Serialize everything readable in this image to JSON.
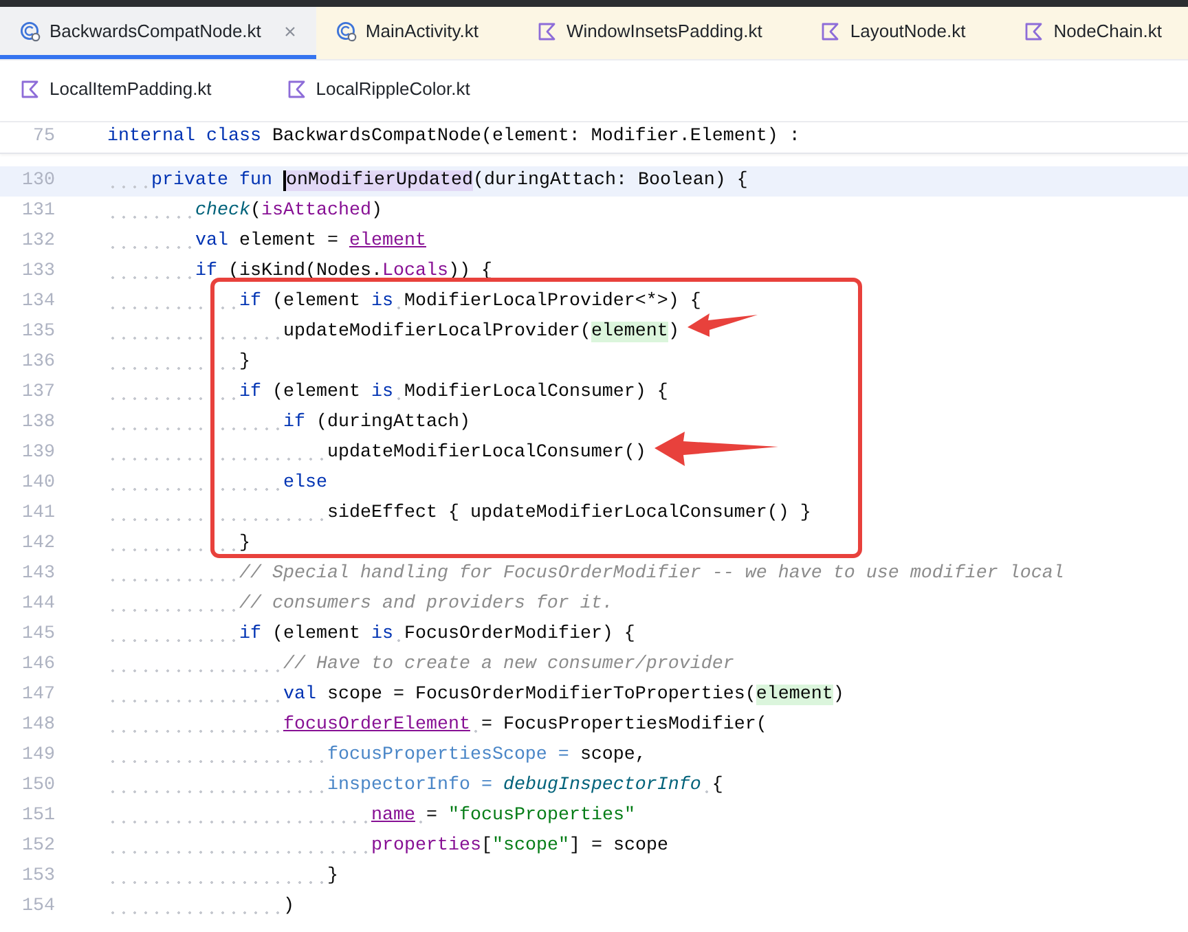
{
  "tab_rows": [
    [
      {
        "label": "BackwardsCompatNode.kt",
        "kind": "class",
        "selected": true
      },
      {
        "label": "MainActivity.kt",
        "kind": "class",
        "selected": false
      },
      {
        "label": "WindowInsetsPadding.kt",
        "kind": "kotlin",
        "selected": false
      },
      {
        "label": "LayoutNode.kt",
        "kind": "kotlin",
        "selected": false
      },
      {
        "label": "NodeChain.kt",
        "kind": "kotlin",
        "selected": false
      }
    ],
    [
      {
        "label": "LocalItemPadding.kt",
        "kind": "kotlin",
        "selected": false
      },
      {
        "label": "LocalRippleColor.kt",
        "kind": "kotlin",
        "selected": false
      }
    ]
  ],
  "sticky_line": {
    "number": "75",
    "tokens": [
      {
        "text": "internal class ",
        "kind": "kw"
      },
      {
        "text": "BackwardsCompatNode(element: Modifier.Element) :",
        "kind": "plain"
      }
    ]
  },
  "lines": [
    {
      "number": "130",
      "current": true,
      "tokens": [
        {
          "text": "    private fun ",
          "kind": "kw"
        },
        {
          "text": "onModifierUpdated",
          "kind": "plain",
          "declaration": true,
          "caret": true
        },
        {
          "text": "(duringAttach: Boolean) {",
          "kind": "plain"
        }
      ]
    },
    {
      "number": "131",
      "current": false,
      "tokens": [
        {
          "text": "        check",
          "kind": "fn"
        },
        {
          "text": "(",
          "kind": "plain"
        },
        {
          "text": "isAttached",
          "kind": "prop"
        },
        {
          "text": ")",
          "kind": "plain"
        }
      ]
    },
    {
      "number": "132",
      "current": false,
      "tokens": [
        {
          "text": "        val ",
          "kind": "kw"
        },
        {
          "text": "element = ",
          "kind": "plain"
        },
        {
          "text": "element",
          "kind": "prop",
          "underlined": true
        }
      ]
    },
    {
      "number": "133",
      "current": false,
      "tokens": [
        {
          "text": "        if ",
          "kind": "kw"
        },
        {
          "text": "(isKind(Nodes.",
          "kind": "plain"
        },
        {
          "text": "Locals",
          "kind": "prop"
        },
        {
          "text": ")) {",
          "kind": "plain"
        }
      ]
    },
    {
      "number": "134",
      "current": false,
      "tokens": [
        {
          "text": "            if ",
          "kind": "kw"
        },
        {
          "text": "(element ",
          "kind": "plain"
        },
        {
          "text": "is",
          "kind": "kw"
        },
        {
          "text": " ModifierLocalProvider<*>) {",
          "kind": "plain"
        }
      ]
    },
    {
      "number": "135",
      "current": false,
      "tokens": [
        {
          "text": "                updateModifierLocalProvider(",
          "kind": "plain"
        },
        {
          "text": "element",
          "kind": "plain",
          "usage": true
        },
        {
          "text": ")",
          "kind": "plain"
        }
      ]
    },
    {
      "number": "136",
      "current": false,
      "tokens": [
        {
          "text": "            }",
          "kind": "plain"
        }
      ]
    },
    {
      "number": "137",
      "current": false,
      "tokens": [
        {
          "text": "            if ",
          "kind": "kw"
        },
        {
          "text": "(element ",
          "kind": "plain"
        },
        {
          "text": "is",
          "kind": "kw"
        },
        {
          "text": " ModifierLocalConsumer) {",
          "kind": "plain"
        }
      ]
    },
    {
      "number": "138",
      "current": false,
      "tokens": [
        {
          "text": "                if ",
          "kind": "kw"
        },
        {
          "text": "(duringAttach)",
          "kind": "plain"
        }
      ]
    },
    {
      "number": "139",
      "current": false,
      "tokens": [
        {
          "text": "                    updateModifierLocalConsumer()",
          "kind": "plain"
        }
      ]
    },
    {
      "number": "140",
      "current": false,
      "tokens": [
        {
          "text": "                else",
          "kind": "kw"
        }
      ]
    },
    {
      "number": "141",
      "current": false,
      "tokens": [
        {
          "text": "                    sideEffect { updateModifierLocalConsumer() }",
          "kind": "plain"
        }
      ]
    },
    {
      "number": "142",
      "current": false,
      "tokens": [
        {
          "text": "            }",
          "kind": "plain"
        }
      ]
    },
    {
      "number": "143",
      "current": false,
      "tokens": [
        {
          "text": "            // Special handling for FocusOrderModifier -- we have to use modifier local",
          "kind": "comment"
        }
      ]
    },
    {
      "number": "144",
      "current": false,
      "tokens": [
        {
          "text": "            // consumers and providers for it.",
          "kind": "comment"
        }
      ]
    },
    {
      "number": "145",
      "current": false,
      "tokens": [
        {
          "text": "            if ",
          "kind": "kw"
        },
        {
          "text": "(element ",
          "kind": "plain"
        },
        {
          "text": "is",
          "kind": "kw"
        },
        {
          "text": " FocusOrderModifier) {",
          "kind": "plain"
        }
      ]
    },
    {
      "number": "146",
      "current": false,
      "tokens": [
        {
          "text": "                // Have to create a new consumer/provider",
          "kind": "comment"
        }
      ]
    },
    {
      "number": "147",
      "current": false,
      "tokens": [
        {
          "text": "                val ",
          "kind": "kw"
        },
        {
          "text": "scope = FocusOrderModifierToProperties(",
          "kind": "plain"
        },
        {
          "text": "element",
          "kind": "plain",
          "usage": true
        },
        {
          "text": ")",
          "kind": "plain"
        }
      ]
    },
    {
      "number": "148",
      "current": false,
      "tokens": [
        {
          "text": "                focusOrderElement",
          "kind": "prop",
          "underlined": true
        },
        {
          "text": " = FocusPropertiesModifier(",
          "kind": "plain"
        }
      ]
    },
    {
      "number": "149",
      "current": false,
      "tokens": [
        {
          "text": "                    focusPropertiesScope = ",
          "kind": "arg"
        },
        {
          "text": "scope,",
          "kind": "plain"
        }
      ]
    },
    {
      "number": "150",
      "current": false,
      "tokens": [
        {
          "text": "                    inspectorInfo = ",
          "kind": "arg"
        },
        {
          "text": "debugInspectorInfo",
          "kind": "fn"
        },
        {
          "text": " {",
          "kind": "plain"
        }
      ]
    },
    {
      "number": "151",
      "current": false,
      "tokens": [
        {
          "text": "                        name",
          "kind": "prop",
          "underlined": true
        },
        {
          "text": " = ",
          "kind": "plain"
        },
        {
          "text": "\"focusProperties\"",
          "kind": "string"
        }
      ]
    },
    {
      "number": "152",
      "current": false,
      "tokens": [
        {
          "text": "                        properties",
          "kind": "prop"
        },
        {
          "text": "[",
          "kind": "plain"
        },
        {
          "text": "\"scope\"",
          "kind": "string"
        },
        {
          "text": "] = scope",
          "kind": "plain"
        }
      ]
    },
    {
      "number": "153",
      "current": false,
      "tokens": [
        {
          "text": "                    }",
          "kind": "plain"
        }
      ]
    },
    {
      "number": "154",
      "current": false,
      "tokens": [
        {
          "text": "                )",
          "kind": "plain"
        }
      ]
    }
  ]
}
